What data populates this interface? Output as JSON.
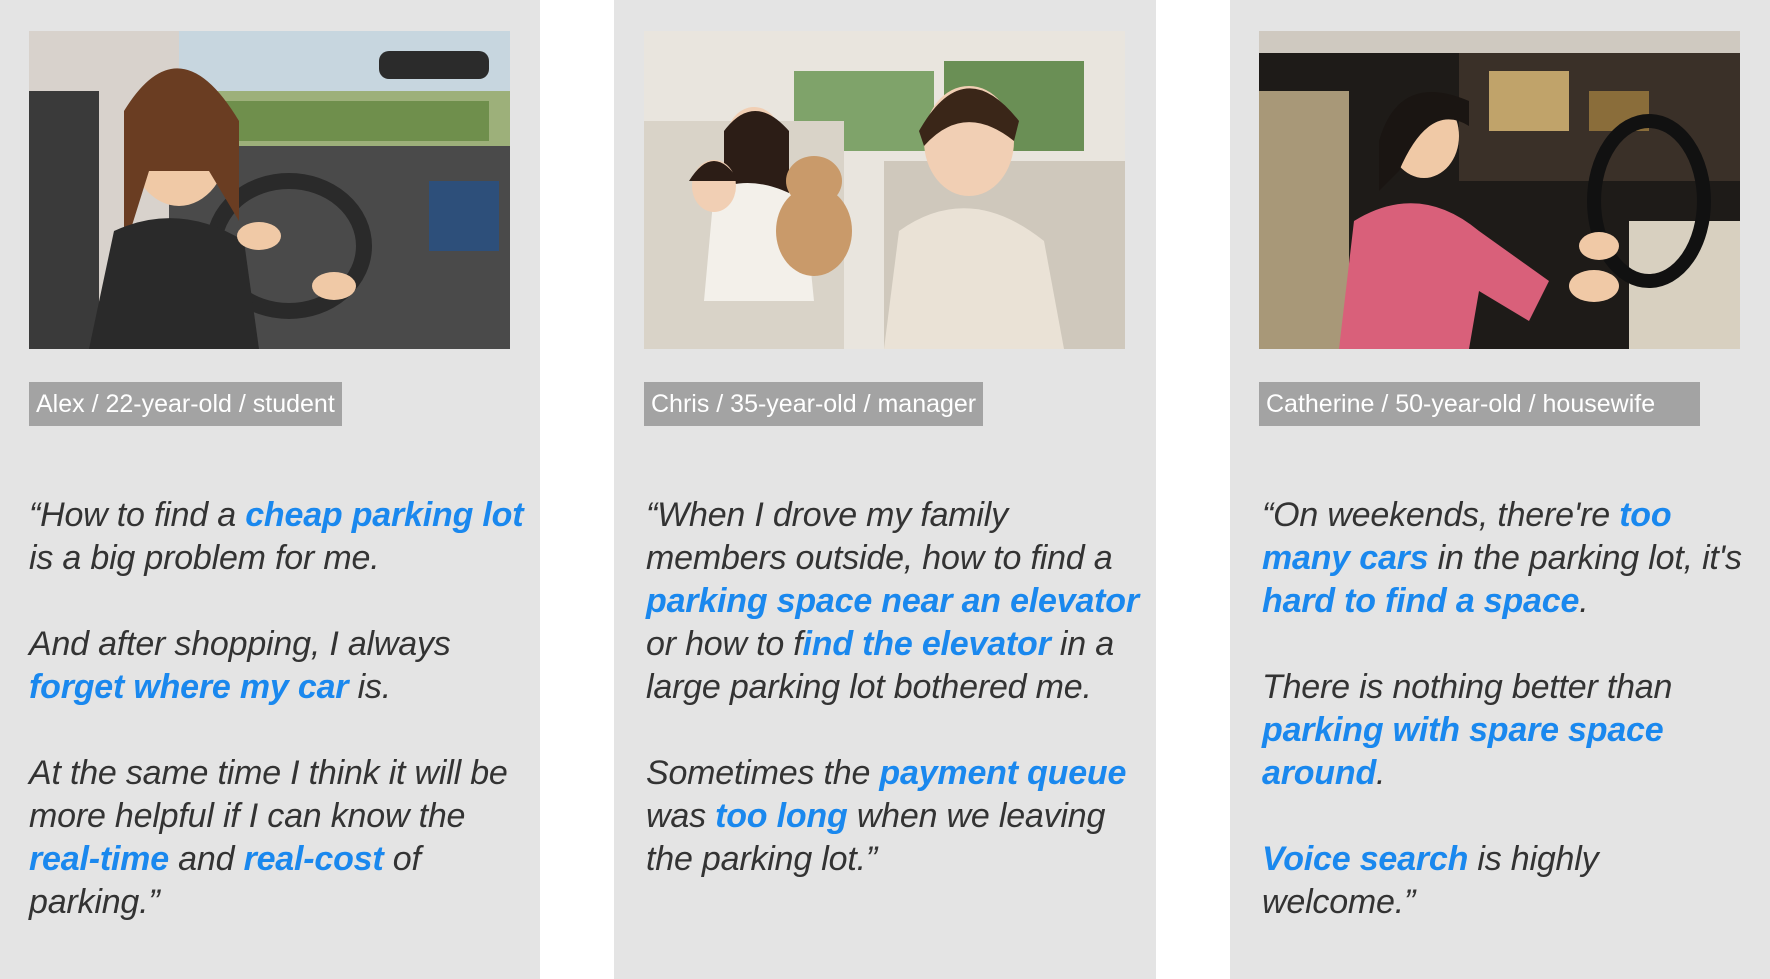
{
  "colors": {
    "card_bg": "#e4e4e4",
    "caption_bg": "#a3a3a3",
    "highlight": "#1a88ee",
    "text": "#333333"
  },
  "personas": [
    {
      "caption": "Alex / 22-year-old / student",
      "photo": "woman-driving-car-photo",
      "paragraphs": [
        [
          "“How to find a ",
          {
            "hl": "cheap parking lot"
          },
          " is a big problem for me."
        ],
        [
          "And after shopping, I always ",
          {
            "hl": "forget where my car"
          },
          " is."
        ],
        [
          "At the same time I think it will be more helpful if I can know the ",
          {
            "hl": "real-time"
          },
          " and ",
          {
            "hl": "real-cost"
          },
          " of parking.”"
        ]
      ]
    },
    {
      "caption": "Chris / 35-year-old / manager",
      "photo": "family-in-car-photo",
      "paragraphs": [
        [
          "“When I drove my family members outside, how to find a ",
          {
            "hl": "parking space near an elevator"
          },
          " or how to f",
          {
            "hl": "ind the elevator"
          },
          " in a large parking lot bothered me."
        ],
        [
          "Sometimes the ",
          {
            "hl": "payment queue"
          },
          " was ",
          {
            "hl": "too long"
          },
          " when we leaving the parking lot.”"
        ]
      ]
    },
    {
      "caption": "Catherine / 50-year-old / housewife",
      "photo": "woman-driving-at-night-photo",
      "paragraphs": [
        [
          "“On weekends, there're ",
          {
            "hl": "too many cars"
          },
          " in the parking lot, it's ",
          {
            "hl": "hard to find a space"
          },
          "."
        ],
        [
          "There is nothing better than ",
          {
            "hl": "parking with spare space around"
          },
          "."
        ],
        [
          {
            "hl": "Voice search"
          },
          " is highly welcome.”"
        ]
      ]
    }
  ]
}
